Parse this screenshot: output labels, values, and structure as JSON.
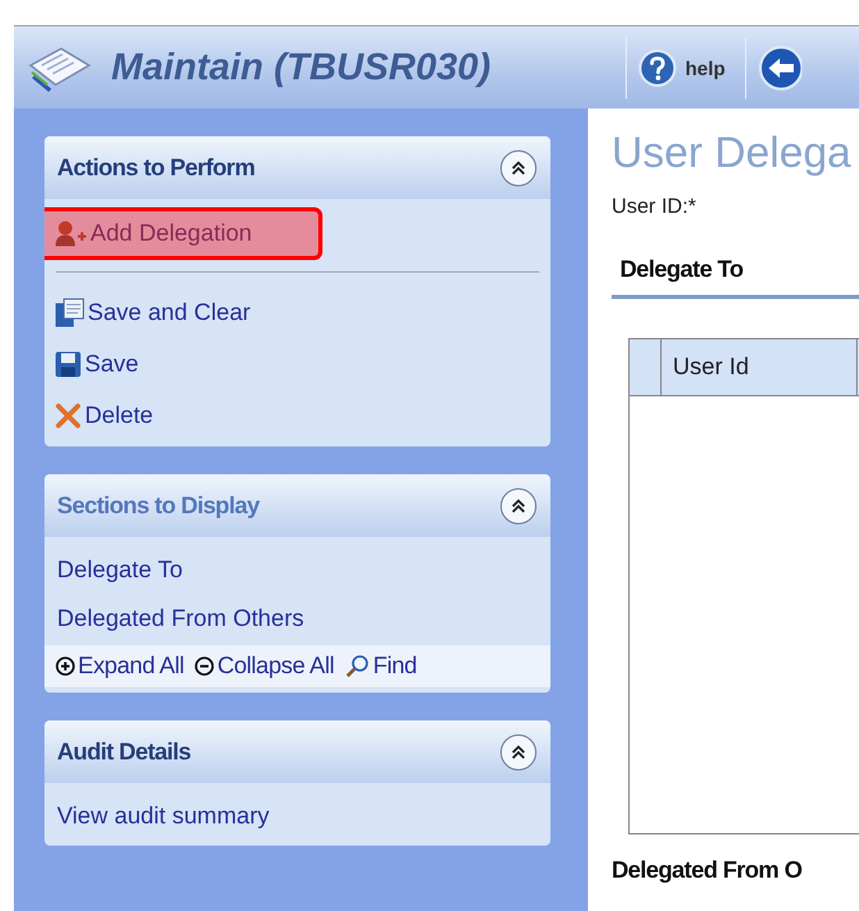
{
  "header": {
    "title": "Maintain (TBUSR030)",
    "buttons": [
      {
        "kind": "help",
        "label": "help"
      },
      {
        "kind": "back"
      }
    ]
  },
  "sidebar": {
    "panels": [
      {
        "title": "Actions to Perform",
        "expanded": true,
        "muted": false,
        "groups": [
          [
            {
              "kind": "add",
              "label": "Add Delegation",
              "highlighted": true
            }
          ],
          [
            {
              "kind": "save-clear",
              "label": "Save and Clear",
              "highlighted": false
            },
            {
              "kind": "save",
              "label": "Save",
              "highlighted": false
            },
            {
              "kind": "delete",
              "label": "Delete",
              "highlighted": false
            }
          ]
        ]
      },
      {
        "title": "Sections to Display",
        "expanded": true,
        "muted": true,
        "groups": [
          [
            {
              "kind": "link",
              "label": "Delegate To",
              "highlighted": false
            },
            {
              "kind": "link",
              "label": "Delegated From Others",
              "highlighted": false
            }
          ]
        ],
        "tools": [
          {
            "kind": "expand",
            "label": "Expand All"
          },
          {
            "kind": "collapse",
            "label": "Collapse All"
          },
          {
            "kind": "find",
            "label": "Find"
          }
        ]
      },
      {
        "title": "Audit Details",
        "expanded": true,
        "muted": false,
        "groups": [
          [
            {
              "kind": "link",
              "label": "View audit summary",
              "highlighted": false
            }
          ]
        ]
      }
    ]
  },
  "main": {
    "title": "User Delega",
    "field_label": "User ID:*",
    "section": "Delegate To",
    "table": {
      "columns": [
        "User Id"
      ]
    },
    "next_section": "Delegated From O"
  }
}
